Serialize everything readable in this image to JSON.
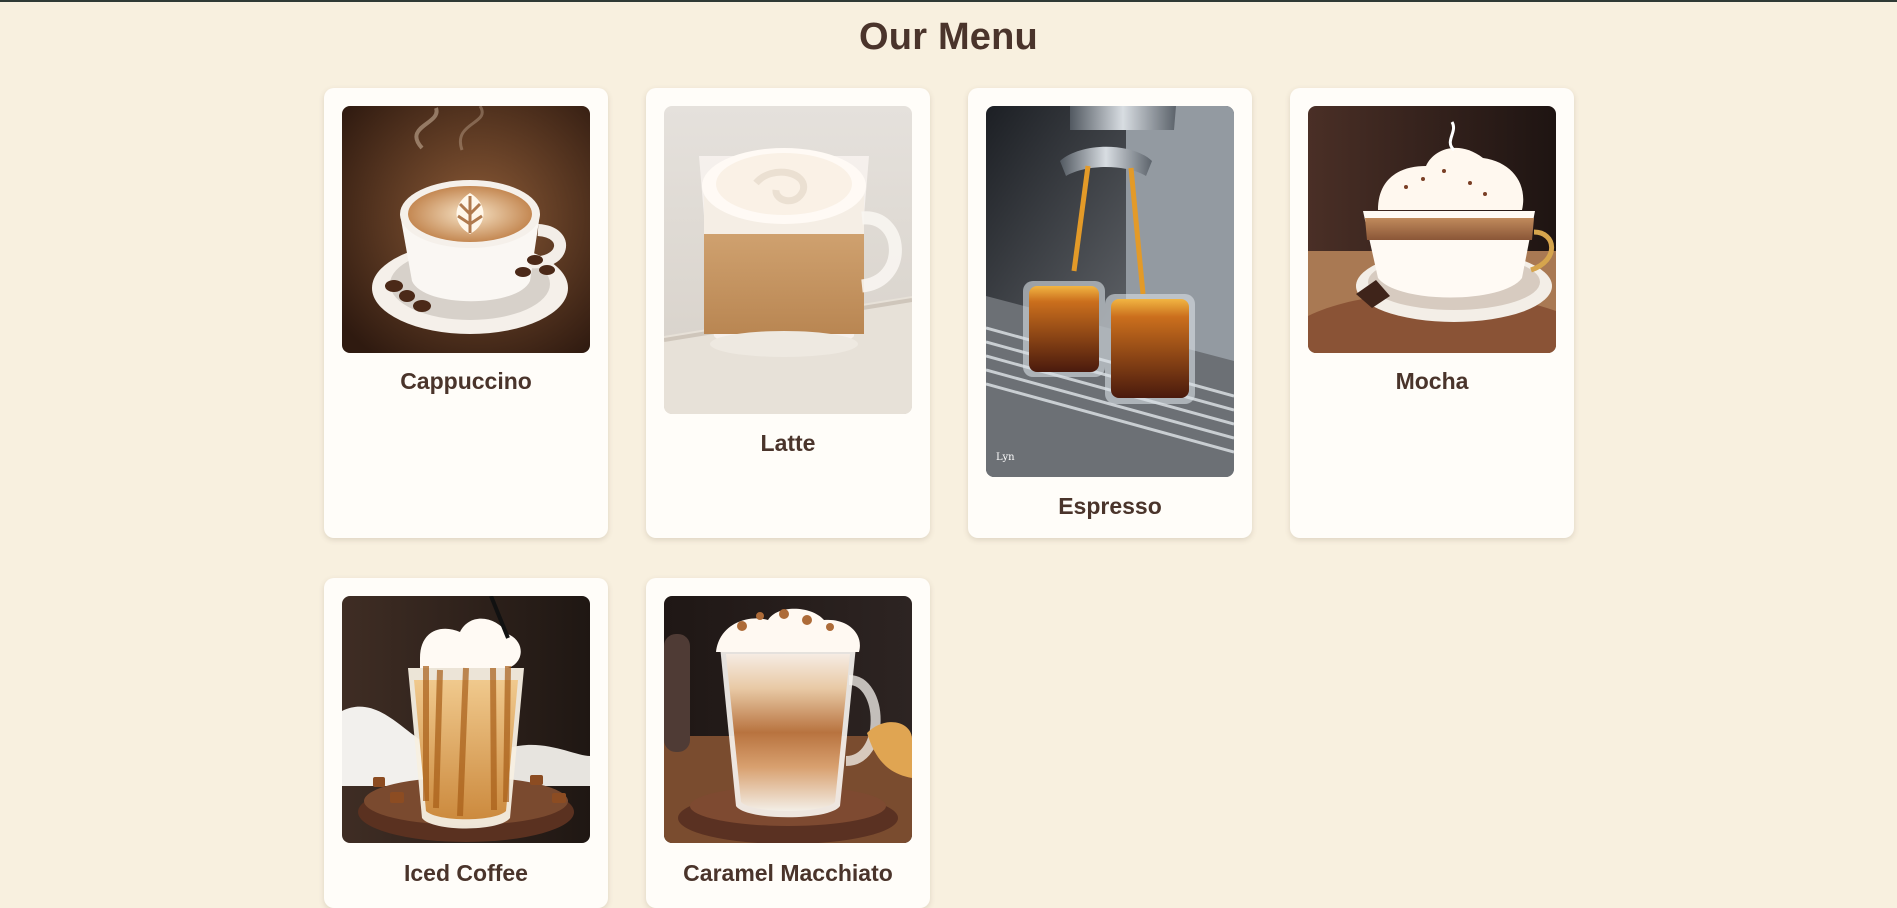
{
  "page": {
    "title": "Our Menu"
  },
  "menu": {
    "items": [
      {
        "name": "Cappuccino",
        "image": "cappuccino-photo"
      },
      {
        "name": "Latte",
        "image": "latte-photo"
      },
      {
        "name": "Espresso",
        "image": "espresso-photo"
      },
      {
        "name": "Mocha",
        "image": "mocha-photo"
      },
      {
        "name": "Iced Coffee",
        "image": "iced-coffee-photo"
      },
      {
        "name": "Caramel Macchiato",
        "image": "caramel-macchiato-photo"
      }
    ]
  },
  "colors": {
    "background": "#f8f0df",
    "card": "#fffdf9",
    "text": "#4a342b",
    "top_border": "#2f3a35"
  }
}
